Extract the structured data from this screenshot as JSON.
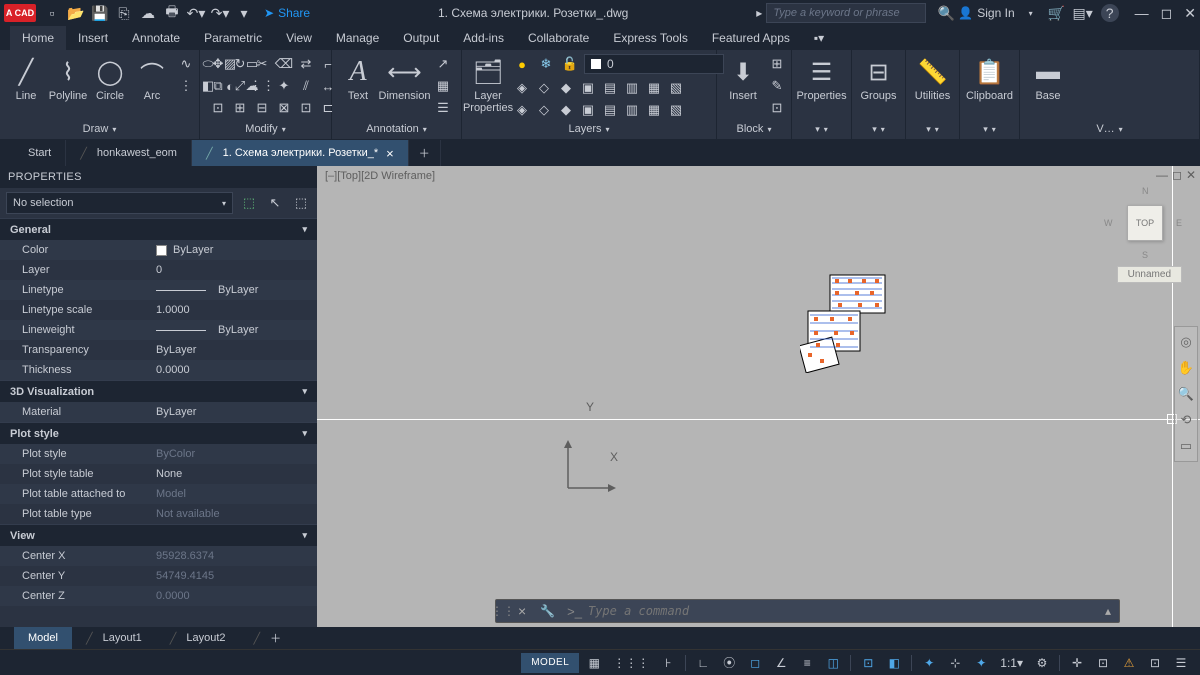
{
  "app": {
    "logo": "A CAD"
  },
  "title": "1. Схема электрики. Розетки_.dwg",
  "search": {
    "placeholder": "Type a keyword or phrase"
  },
  "signin": "Sign In",
  "share": "Share",
  "menus": [
    "Home",
    "Insert",
    "Annotate",
    "Parametric",
    "View",
    "Manage",
    "Output",
    "Add-ins",
    "Collaborate",
    "Express Tools",
    "Featured Apps"
  ],
  "ribbon": {
    "draw": {
      "label": "Draw",
      "items": [
        "Line",
        "Polyline",
        "Circle",
        "Arc"
      ]
    },
    "modify": {
      "label": "Modify"
    },
    "annotation": {
      "label": "Annotation",
      "text": "Text",
      "dim": "Dimension"
    },
    "layers": {
      "label": "Layers",
      "btn": "Layer\nProperties",
      "current": "0"
    },
    "block": {
      "label": "Block",
      "btn": "Insert"
    },
    "properties": {
      "label": "Properties"
    },
    "groups": {
      "label": "Groups"
    },
    "utilities": {
      "label": "Utilities"
    },
    "clipboard": {
      "label": "Clipboard"
    },
    "view": {
      "label": "V…",
      "btn": "Base"
    }
  },
  "doctabs": [
    "Start",
    "honkawest_eom",
    "1. Схема электрики. Розетки_*"
  ],
  "properties": {
    "title": "PROPERTIES",
    "selection": "No selection",
    "sections": [
      {
        "name": "General",
        "rows": [
          {
            "k": "Color",
            "v": "ByLayer",
            "type": "color"
          },
          {
            "k": "Layer",
            "v": "0"
          },
          {
            "k": "Linetype",
            "v": "ByLayer",
            "type": "line"
          },
          {
            "k": "Linetype scale",
            "v": "1.0000"
          },
          {
            "k": "Lineweight",
            "v": "ByLayer",
            "type": "line"
          },
          {
            "k": "Transparency",
            "v": "ByLayer"
          },
          {
            "k": "Thickness",
            "v": "0.0000"
          }
        ]
      },
      {
        "name": "3D Visualization",
        "rows": [
          {
            "k": "Material",
            "v": "ByLayer"
          }
        ]
      },
      {
        "name": "Plot style",
        "rows": [
          {
            "k": "Plot style",
            "v": "ByColor",
            "dim": true
          },
          {
            "k": "Plot style table",
            "v": "None"
          },
          {
            "k": "Plot table attached to",
            "v": "Model",
            "dim": true
          },
          {
            "k": "Plot table type",
            "v": "Not available",
            "dim": true
          }
        ]
      },
      {
        "name": "View",
        "rows": [
          {
            "k": "Center X",
            "v": "95928.6374",
            "dim": true
          },
          {
            "k": "Center Y",
            "v": "54749.4145",
            "dim": true
          },
          {
            "k": "Center Z",
            "v": "0.0000",
            "dim": true
          }
        ]
      }
    ]
  },
  "viewport": {
    "label": "[–][Top][2D Wireframe]",
    "ucs_x": "X",
    "ucs_y": "Y",
    "cube": "TOP",
    "wcs": "Unnamed",
    "compass": {
      "n": "N",
      "s": "S",
      "e": "E",
      "w": "W"
    }
  },
  "cmdline": {
    "prompt": ">_",
    "placeholder": "Type a command"
  },
  "layouts": [
    "Model",
    "Layout1",
    "Layout2"
  ],
  "status": {
    "model": "MODEL",
    "scale": "1:1"
  }
}
